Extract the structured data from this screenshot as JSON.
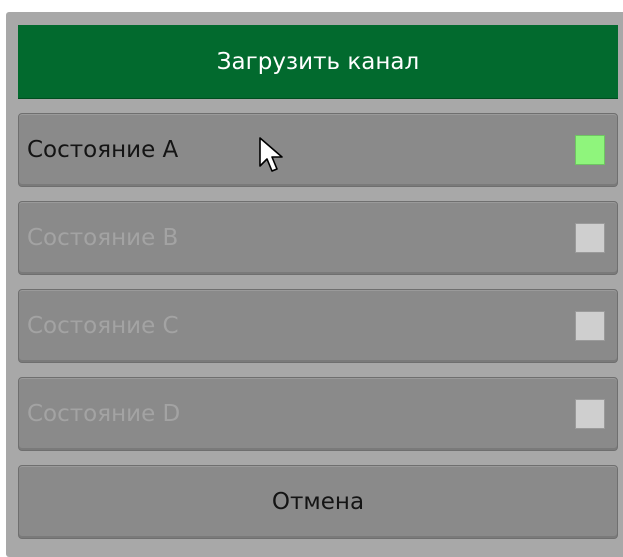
{
  "dialog": {
    "title": "Загрузить канал",
    "states": [
      {
        "label": "Состояние A",
        "enabled": true,
        "indicator": "on",
        "indicator_color": "#8ff57c"
      },
      {
        "label": "Состояние B",
        "enabled": false,
        "indicator": "off",
        "indicator_color": "#cfcfcf"
      },
      {
        "label": "Состояние C",
        "enabled": false,
        "indicator": "off",
        "indicator_color": "#cfcfcf"
      },
      {
        "label": "Состояние D",
        "enabled": false,
        "indicator": "off",
        "indicator_color": "#cfcfcf"
      }
    ],
    "cancel_label": "Отмена"
  },
  "colors": {
    "title_bg": "#026a2e",
    "button_bg": "#8a8a8a",
    "panel_bg": "#a8a8a8",
    "disabled_text": "#a3a3a3"
  },
  "cursor": {
    "icon": "mouse-pointer-icon"
  }
}
